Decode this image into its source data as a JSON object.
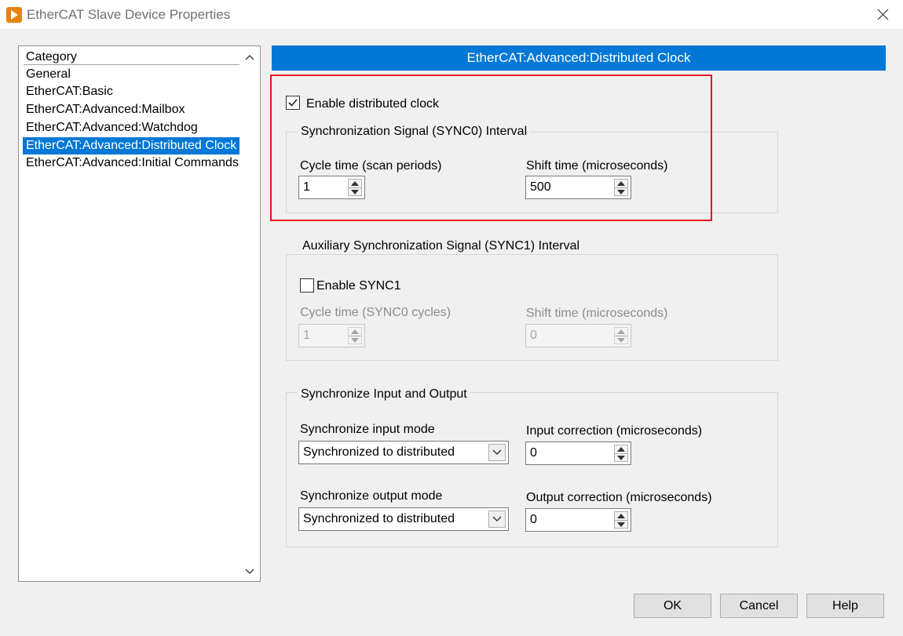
{
  "window": {
    "title": "EtherCAT Slave Device Properties",
    "app_icon": "labview-icon",
    "close_icon": "close-icon"
  },
  "category_list": {
    "header": "Category",
    "items": [
      {
        "label": "General",
        "selected": false
      },
      {
        "label": "EtherCAT:Basic",
        "selected": false
      },
      {
        "label": "EtherCAT:Advanced:Mailbox",
        "selected": false
      },
      {
        "label": "EtherCAT:Advanced:Watchdog",
        "selected": false
      },
      {
        "label": "EtherCAT:Advanced:Distributed Clock",
        "selected": true
      },
      {
        "label": "EtherCAT:Advanced:Initial Commands",
        "selected": false
      }
    ]
  },
  "panel": {
    "header": "EtherCAT:Advanced:Distributed Clock",
    "enable_dc": {
      "label": "Enable distributed clock",
      "checked": true
    },
    "sync0": {
      "title": "Synchronization Signal (SYNC0) Interval",
      "cycle_label": "Cycle time (scan periods)",
      "cycle_value": "1",
      "shift_label": "Shift time (microseconds)",
      "shift_value": "500"
    },
    "sync1": {
      "title": "Auxiliary Synchronization Signal (SYNC1) Interval",
      "enable": {
        "label": "Enable SYNC1",
        "checked": false
      },
      "cycle_label": "Cycle time (SYNC0 cycles)",
      "cycle_value": "1",
      "shift_label": "Shift time (microseconds)",
      "shift_value": "0"
    },
    "sync_io": {
      "title": "Synchronize Input and Output",
      "input_mode_label": "Synchronize input mode",
      "input_mode_value": "Synchronized to distributed",
      "input_corr_label": "Input correction (microseconds)",
      "input_corr_value": "0",
      "output_mode_label": "Synchronize output mode",
      "output_mode_value": "Synchronized to distributed",
      "output_corr_label": "Output correction (microseconds)",
      "output_corr_value": "0"
    }
  },
  "buttons": {
    "ok": "OK",
    "cancel": "Cancel",
    "help": "Help"
  },
  "colors": {
    "accent": "#0078d7",
    "highlight": "#e81123"
  }
}
